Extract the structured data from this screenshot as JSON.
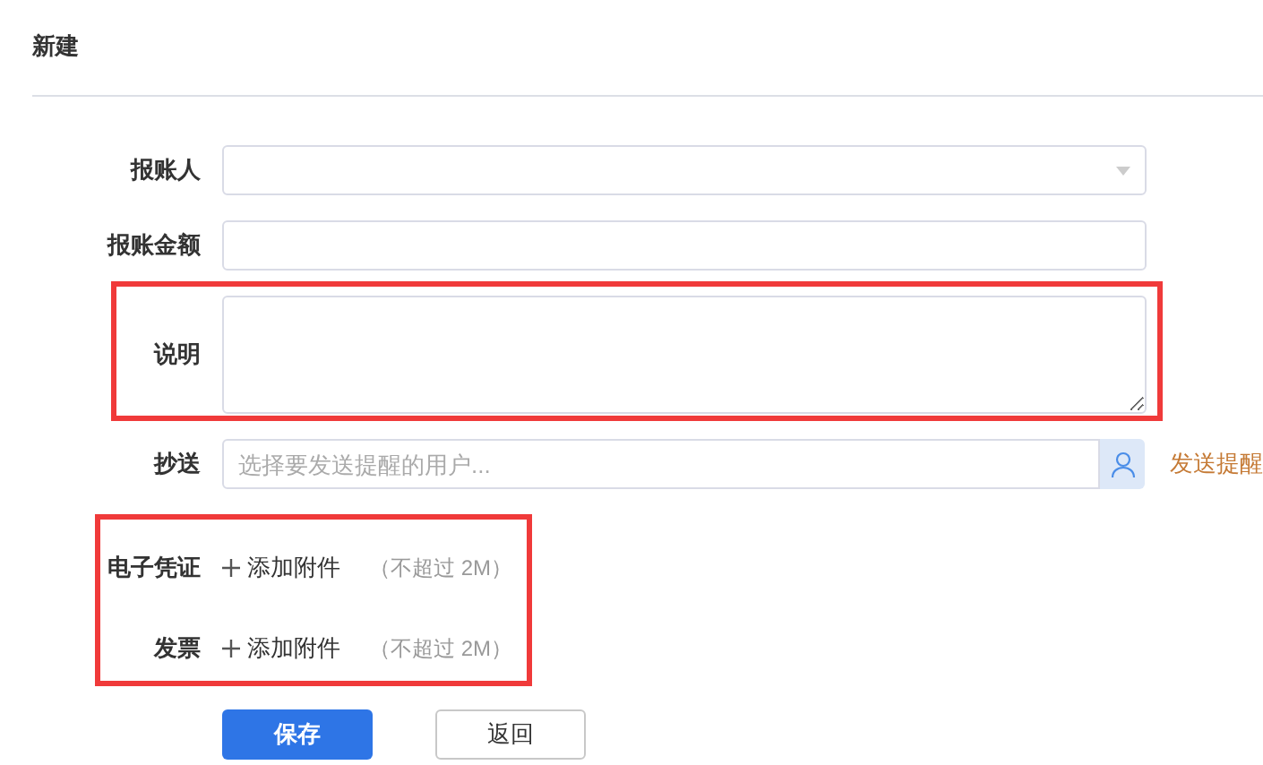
{
  "title": "新建",
  "groups": [
    {
      "highlighted": false,
      "rows": [
        {
          "kind": "select",
          "label": "报账人"
        },
        {
          "kind": "input",
          "label": "报账金额"
        }
      ]
    },
    {
      "highlighted": true,
      "rows": [
        {
          "kind": "textarea",
          "label": "说明"
        }
      ]
    },
    {
      "highlighted": false,
      "rows": [
        {
          "kind": "user-picker",
          "label": "抄送",
          "placeholder": "选择要发送提醒的用户...",
          "link": "发送提醒"
        }
      ]
    },
    {
      "highlighted": true,
      "rows": [
        {
          "kind": "attachment",
          "label": "电子凭证",
          "action": "添加附件",
          "note": "（不超过 2M）"
        },
        {
          "kind": "attachment",
          "label": "发票",
          "action": "添加附件",
          "note": "（不超过 2M）"
        }
      ]
    }
  ],
  "buttons": [
    {
      "kind": "primary",
      "label": "保存"
    },
    {
      "kind": "secondary",
      "label": "返回"
    }
  ]
}
